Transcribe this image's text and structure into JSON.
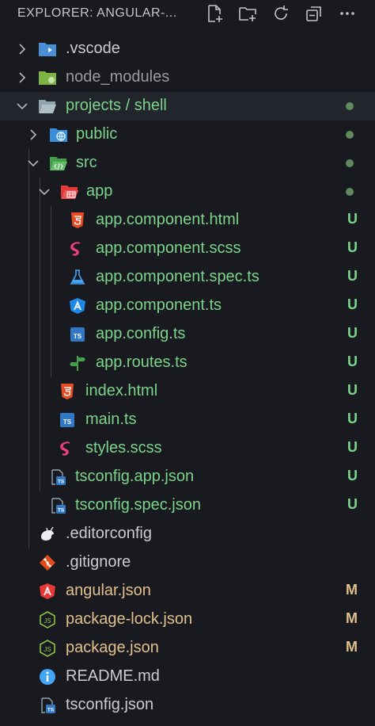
{
  "header": {
    "title": "EXPLORER: ANGULAR-...",
    "icons": [
      "new-file-icon",
      "new-folder-icon",
      "refresh-icon",
      "collapse-all-icon",
      "more-icon"
    ]
  },
  "colors": {
    "background": "#181a1f",
    "untracked": "#7bd48a",
    "modified": "#e2c08d",
    "ignored": "#9a9a9a"
  },
  "tree": {
    "vscode": ".vscode",
    "node_modules": "node_modules",
    "projects_shell": "projects / shell",
    "public": "public",
    "src": "src",
    "app": "app",
    "app_component_html": "app.component.html",
    "app_component_scss": "app.component.scss",
    "app_component_spec_ts": "app.component.spec.ts",
    "app_component_ts": "app.component.ts",
    "app_config_ts": "app.config.ts",
    "app_routes_ts": "app.routes.ts",
    "index_html": "index.html",
    "main_ts": "main.ts",
    "styles_scss": "styles.scss",
    "tsconfig_app_json": "tsconfig.app.json",
    "tsconfig_spec_json": "tsconfig.spec.json",
    "editorconfig": ".editorconfig",
    "gitignore": ".gitignore",
    "angular_json": "angular.json",
    "package_lock_json": "package-lock.json",
    "package_json": "package.json",
    "readme_md": "README.md",
    "tsconfig_json": "tsconfig.json"
  },
  "status": {
    "untracked": "U",
    "modified": "M"
  }
}
